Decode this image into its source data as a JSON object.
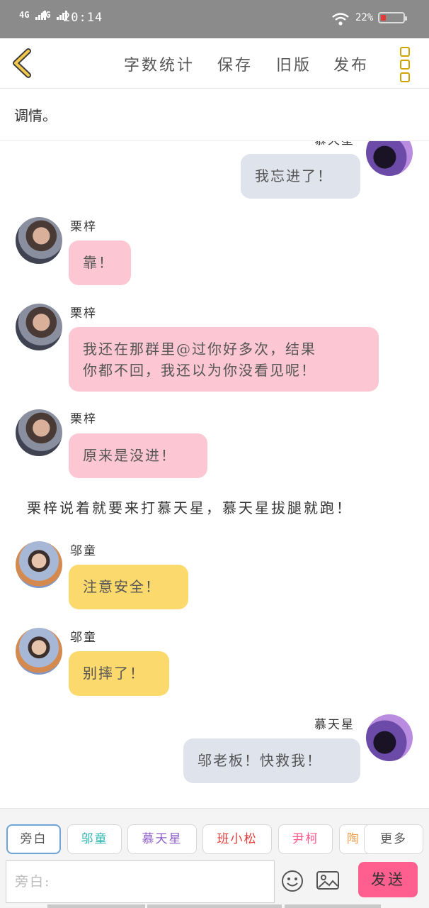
{
  "status_bar": {
    "network_1": "4G",
    "network_2": "4G",
    "time": "20:14",
    "battery_text": "22%",
    "battery_level": 0.22,
    "battery_color": "#e53935"
  },
  "toolbar": {
    "back_icon": "chevron-left-icon",
    "word_count": "字数统计",
    "save": "保存",
    "old_version": "旧版",
    "publish": "发布",
    "more_icon": "vertical-dots-icon",
    "accent": "#d2a400"
  },
  "title": "调情。",
  "messages": [
    {
      "side": "right",
      "name": "慕天星",
      "text": "我忘进了！",
      "color": "#dee3ec"
    },
    {
      "side": "left",
      "name": "栗梓",
      "text": "靠！",
      "color": "#fcc7d3"
    },
    {
      "side": "left",
      "name": "栗梓",
      "text_line1": "我还在那群里@过你好多次，结果",
      "text_line2": "你都不回，我还以为你没看见呢！",
      "color": "#fcc7d3"
    },
    {
      "side": "left",
      "name": "栗梓",
      "text": "原来是没进！",
      "color": "#fcc7d3"
    },
    {
      "type": "narration",
      "text": "栗梓说着就要来打慕天星，慕天星拔腿就跑！"
    },
    {
      "side": "left",
      "name": "邬童",
      "text": "注意安全！",
      "color": "#fbd96c"
    },
    {
      "side": "left",
      "name": "邬童",
      "text": "别摔了！",
      "color": "#fbd96c"
    },
    {
      "side": "right",
      "name": "慕天星",
      "text": "邬老板！快救我！",
      "color": "#dee3ec"
    }
  ],
  "characters": [
    {
      "label": "旁白",
      "color": "#555555"
    },
    {
      "label": "邬童",
      "color": "#2bb5b0"
    },
    {
      "label": "慕天星",
      "color": "#8c5cc9"
    },
    {
      "label": "班小松",
      "color": "#e53935"
    },
    {
      "label": "尹柯",
      "color": "#ff5a8a"
    },
    {
      "label": "陶",
      "color": "#f0a050"
    }
  ],
  "more_characters": "更多",
  "input": {
    "placeholder": "旁白:",
    "emoji_icon": "smiley-icon",
    "image_icon": "image-icon",
    "send": "发送",
    "send_color": "#ff5f8f"
  }
}
